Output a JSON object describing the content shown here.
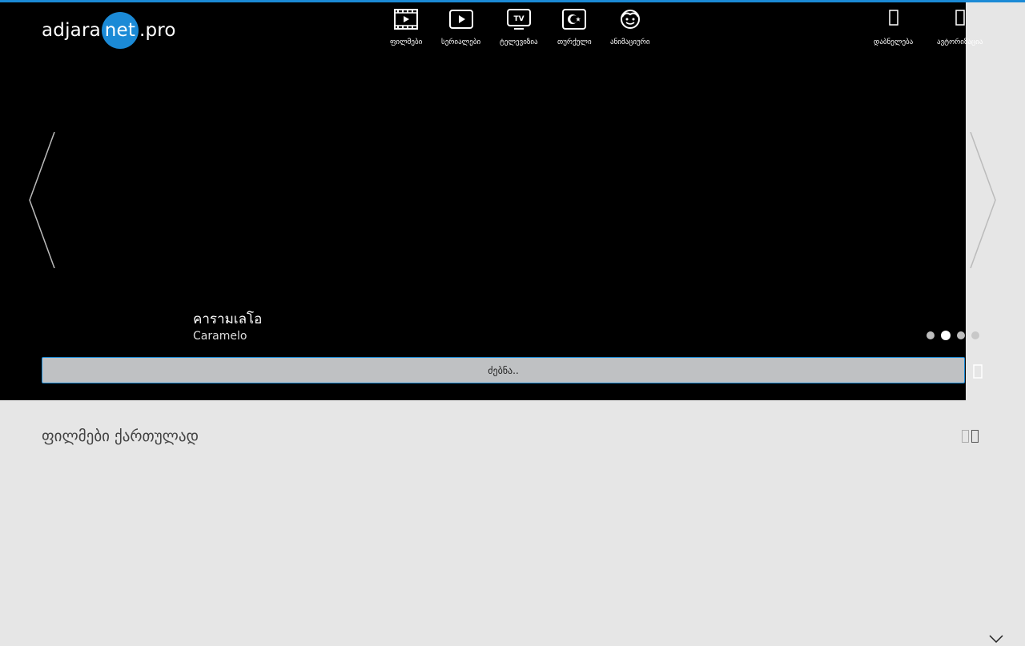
{
  "logo": {
    "part1": "adjara",
    "part2": "net",
    "part3": ".pro"
  },
  "nav": {
    "items": [
      {
        "label": "ფილმები",
        "icon": "film-icon"
      },
      {
        "label": "სერიალები",
        "icon": "play-icon"
      },
      {
        "label": "ტელევიზია",
        "icon": "tv-icon"
      },
      {
        "label": "თურქული",
        "icon": "turkish-flag-icon"
      },
      {
        "label": "ანიმაციური",
        "icon": "cartoon-face-icon"
      }
    ],
    "right": [
      {
        "label": "დაბნელება",
        "icon": "dark-mode-icon"
      },
      {
        "label": "ავტორიზაცია",
        "icon": "login-icon"
      }
    ]
  },
  "slider": {
    "title": "คารามเลโอ",
    "subtitle": "Caramelo",
    "active_dot": 1,
    "dot_count": 4
  },
  "search": {
    "placeholder": "ძებნა.."
  },
  "section": {
    "title": "ფილმები ქართულად"
  },
  "colors": {
    "accent": "#1b8ad6",
    "hero_bg": "#000000",
    "page_bg": "#e6e6e6"
  }
}
